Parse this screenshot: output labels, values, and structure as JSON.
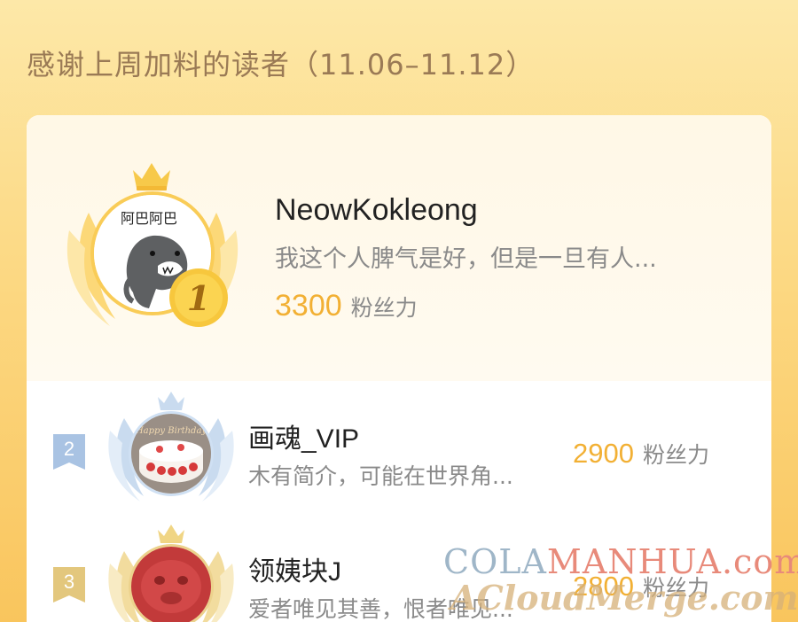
{
  "header": {
    "title": "感谢上周加料的读者（11.06–11.12）"
  },
  "colors": {
    "background_top": "#fde8a8",
    "background_bottom": "#f9c55d",
    "score": "#f2b034",
    "gold": "#f9cc57",
    "silver": "#a9c3e3",
    "bronze": "#e3c77d"
  },
  "readers": [
    {
      "rank": "1",
      "name": "NeowKokleong",
      "bio": "我这个人脾气是好，但是一旦有人...",
      "score": "3300",
      "score_unit": "粉丝力",
      "avatar_text": "阿巴阿巴",
      "icons": [
        "crown-icon",
        "wings-icon",
        "rank-medal-icon"
      ]
    },
    {
      "rank": "2",
      "name": "画魂_VIP",
      "bio": "木有简介，可能在世界角...",
      "score": "2900",
      "score_unit": "粉丝力",
      "avatar_text": "Happy Birthday",
      "icons": [
        "crown-icon",
        "wings-icon",
        "rank-tag-icon"
      ]
    },
    {
      "rank": "3",
      "name": "领姨块J",
      "bio": "爱者唯见其善，恨者唯见...",
      "score": "2800",
      "score_unit": "粉丝力",
      "avatar_text": "",
      "icons": [
        "crown-icon",
        "wings-icon",
        "rank-tag-icon"
      ]
    }
  ],
  "watermark": {
    "line1_part1": "COLA",
    "line1_part2": "MANHUA",
    "line1_part3": ".com",
    "line2": "ACloudMerge.com"
  }
}
